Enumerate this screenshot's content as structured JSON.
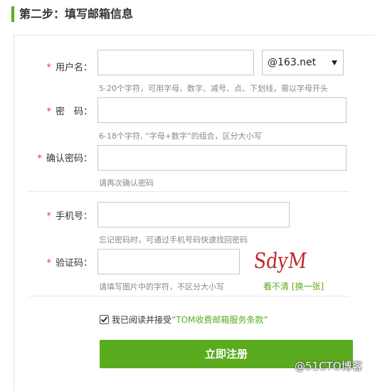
{
  "step_title": "第二步：填写邮箱信息",
  "fields": {
    "username": {
      "label": "用户名：",
      "value": "",
      "hint": "5-20个字符，可用字母、数字、减号、点、下划线，需以字母开头"
    },
    "domain": {
      "selected": "@163.net"
    },
    "password": {
      "label": "密　码：",
      "value": "",
      "hint": "6-18个字符, “字母+数字”的组合，区分大小写"
    },
    "confirm_password": {
      "label": "确认密码：",
      "value": "",
      "hint": "请再次确认密码"
    },
    "phone": {
      "label": "手机号：",
      "value": "",
      "hint": "忘记密码时，可通过手机号码快速找回密码"
    },
    "captcha": {
      "label": "验证码：",
      "value": "",
      "hint": "请填写图片中的字符，不区分大小写",
      "image_text": "SdyM",
      "refresh": "看不清 [换一张]"
    }
  },
  "required_mark": "*",
  "agreement": {
    "checked": true,
    "prefix": "我已阅读并接受",
    "terms": "“TOM收费邮箱服务条款”"
  },
  "submit_label": "立即注册",
  "watermark": "@51CTO博客",
  "colors": {
    "accent": "#5aac1e",
    "required": "#e4393c",
    "captcha": "#c0262d"
  }
}
